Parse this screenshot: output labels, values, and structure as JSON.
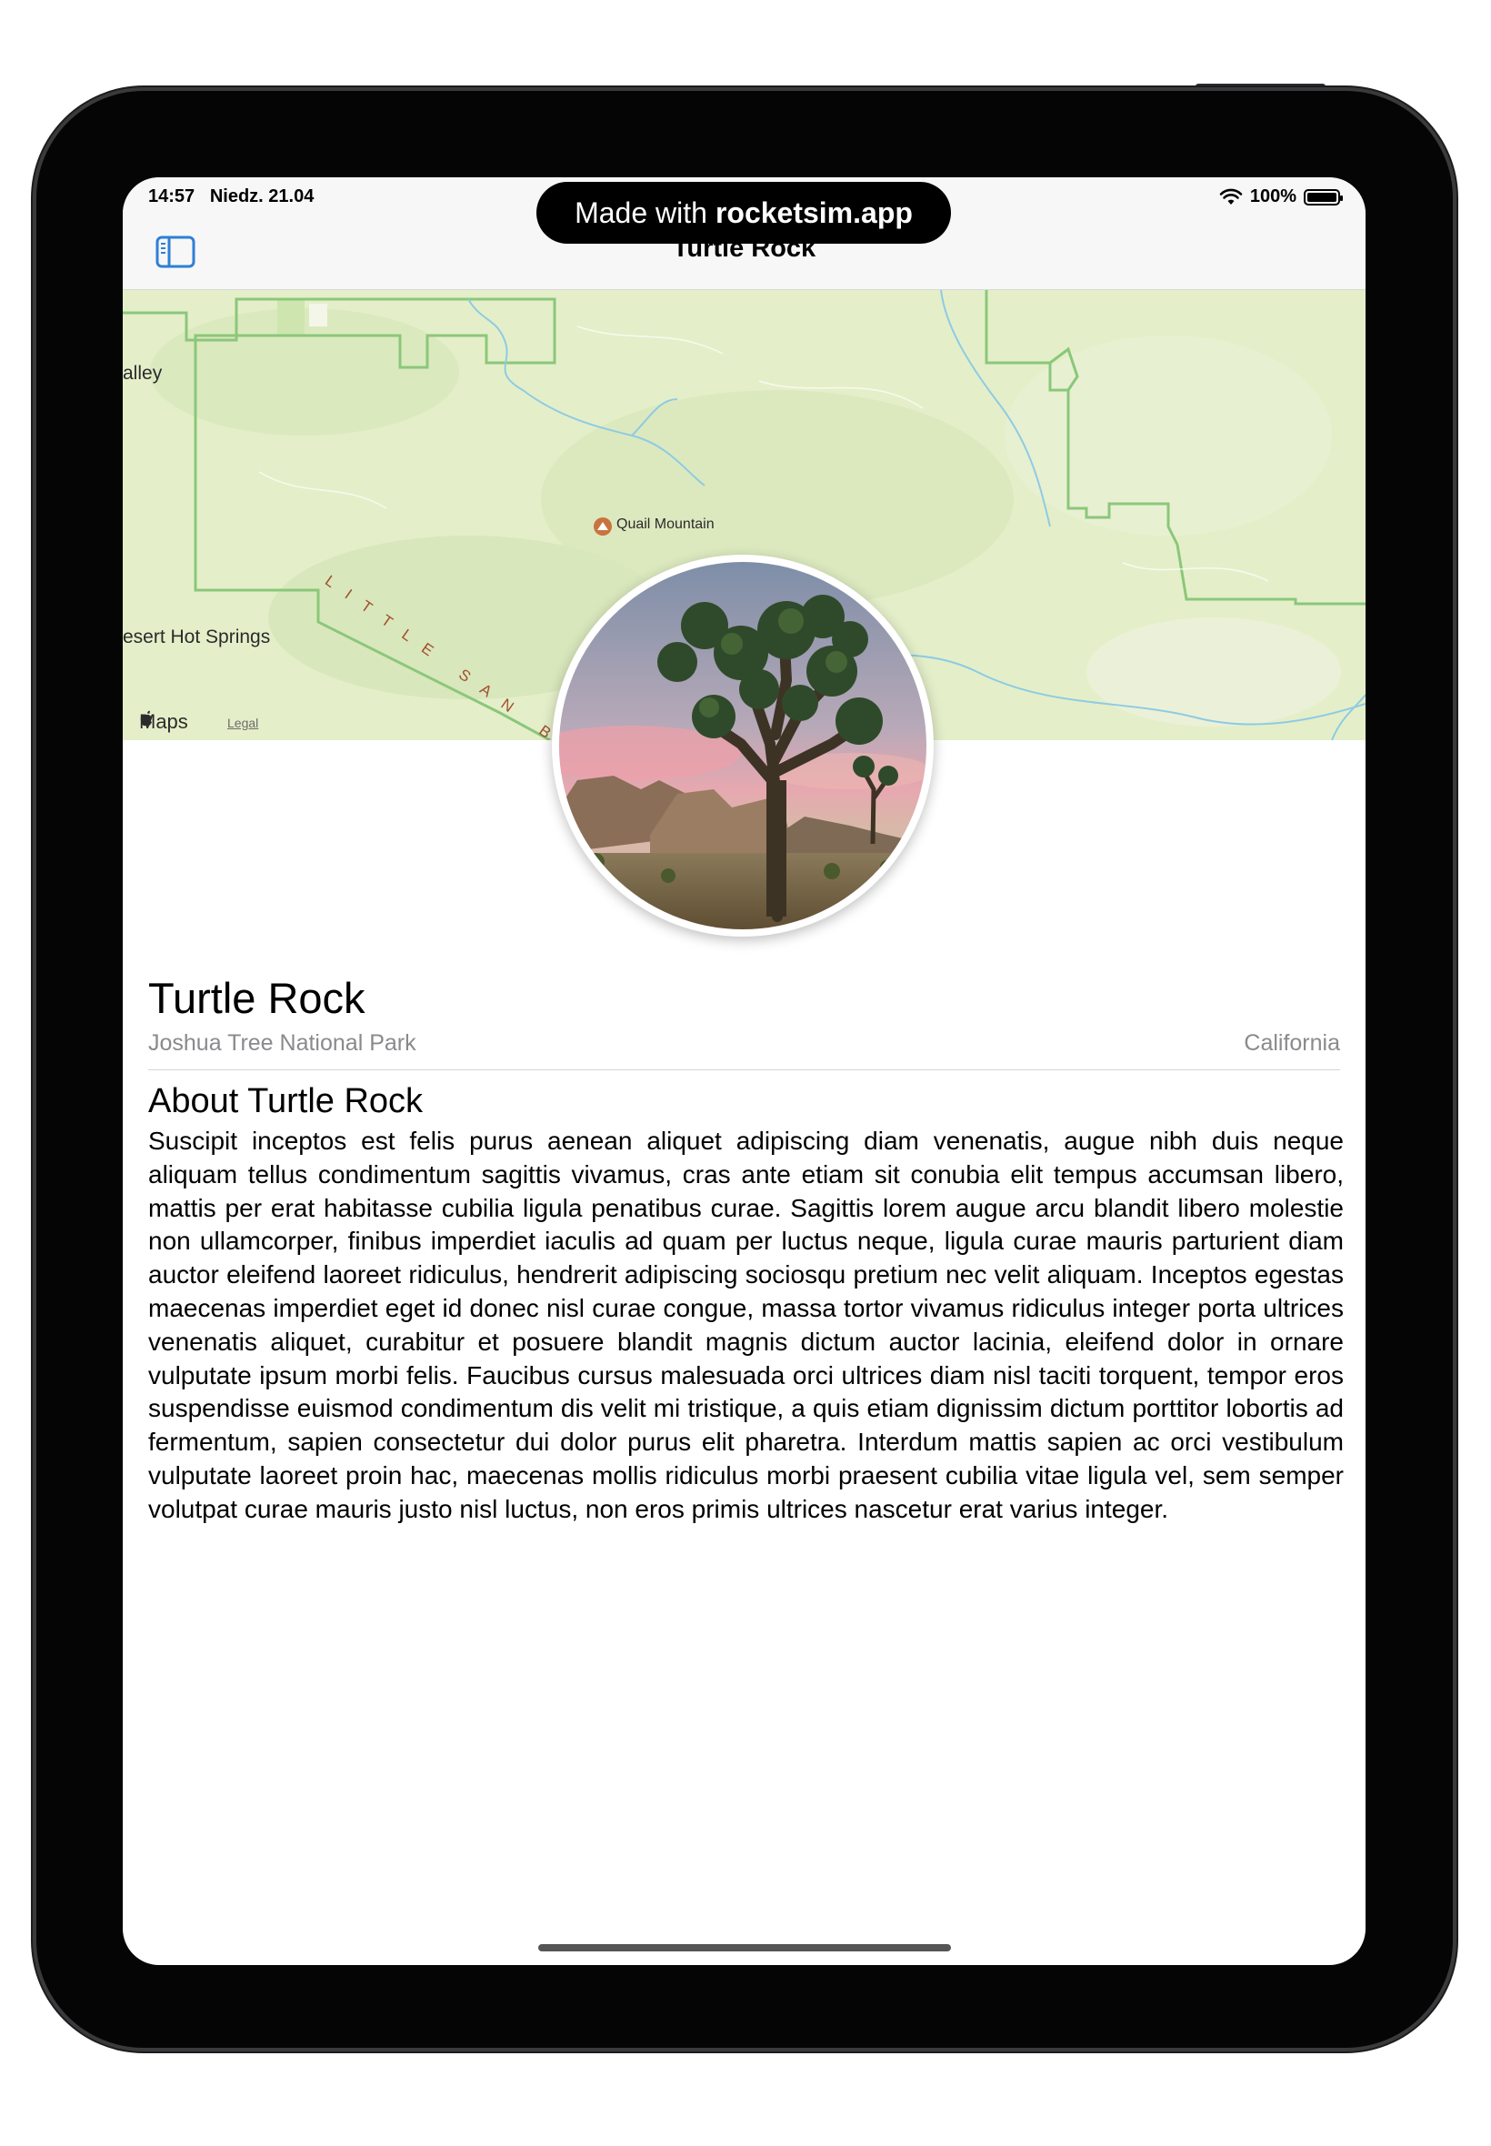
{
  "status_bar": {
    "time": "14:57",
    "date": "Niedz. 21.04",
    "battery": "100%"
  },
  "recording_pill": {
    "prefix": "Made with",
    "brand": "rocketsim.app"
  },
  "nav": {
    "title": "Turtle Rock",
    "sidebar_icon": "sidebar-toggle-icon"
  },
  "map": {
    "labels": {
      "valley": "alley",
      "hot_springs": "esert Hot Springs",
      "quail_mountain": "Quail Mountain",
      "range": "LITTLE SAN B",
      "maps_logo": "Maps",
      "legal": "Legal"
    },
    "colors": {
      "land": "#e4efc9",
      "boundary": "#8bc77a",
      "water": "#8ecbe3"
    }
  },
  "landmark": {
    "name": "Turtle Rock",
    "park": "Joshua Tree National Park",
    "state": "California"
  },
  "about": {
    "heading": "About Turtle Rock",
    "description": "Suscipit inceptos est felis purus aenean aliquet adipiscing diam venenatis, augue nibh duis neque aliquam tellus condimentum sagittis vivamus, cras ante etiam sit conubia elit tempus accumsan libero, mattis per erat habitasse cubilia ligula penatibus curae. Sagittis lorem augue arcu blandit libero molestie non ullamcorper, finibus imperdiet iaculis ad quam per luctus neque, ligula curae mauris parturient diam auctor eleifend laoreet ridiculus, hendrerit adipiscing sociosqu pretium nec velit aliquam. Inceptos egestas maecenas imperdiet eget id donec nisl curae congue, massa tortor vivamus ridiculus integer porta ultrices venenatis aliquet, curabitur et posuere blandit magnis dictum auctor lacinia, eleifend dolor in ornare vulputate ipsum morbi felis. Faucibus cursus malesuada orci ultrices diam nisl taciti torquent, tempor eros suspendisse euismod condimentum dis velit mi tristique, a quis etiam dignissim dictum porttitor lobortis ad fermentum, sapien consectetur dui dolor purus elit pharetra. Interdum mattis sapien ac orci vestibulum vulputate laoreet proin hac, maecenas mollis ridiculus morbi praesent cubilia vitae ligula vel, sem semper volutpat curae mauris justo nisl luctus, non eros primis ultrices nascetur erat varius integer."
  }
}
